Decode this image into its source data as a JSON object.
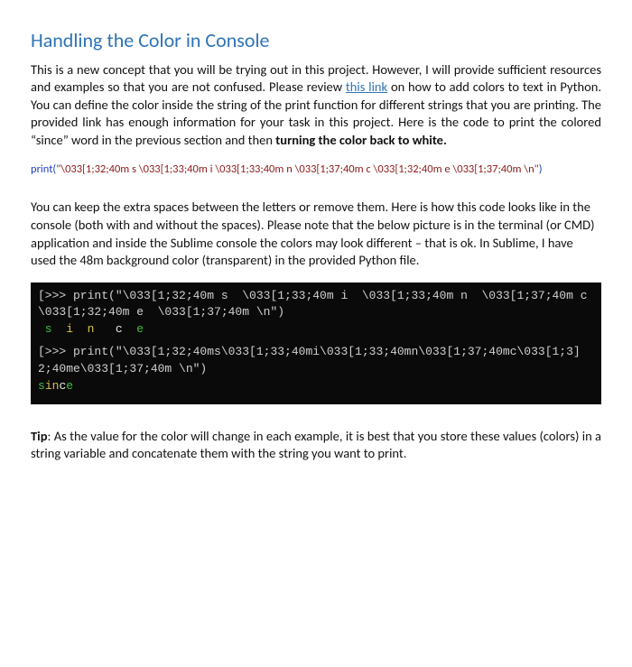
{
  "heading": "Handling the Color in Console",
  "intro": {
    "part1": "This is a new concept that you will be trying out in this project. However, I will provide sufficient resources and examples so that you are not confused. Please review ",
    "link_text": "this link",
    "part2": " on how to add colors to text in Python. You can define the color inside the string of the print function for different strings that you are printing. The provided link has enough information for your task in this project. Here is the code to print the colored “since” word in the previous section and then ",
    "bold_tail": "turning the color back to white."
  },
  "code_inline": {
    "lead": "print(",
    "string": "\"\\033[1;32;40m s \\033[1;33;40m i \\033[1;33;40m n \\033[1;37;40m c \\033[1;32;40m e \\033[1;37;40m \\n\"",
    "tail": ")"
  },
  "mid_para": "You can keep the extra spaces between the letters or remove them. Here is how this code looks like in the console (both with and without the spaces). Please note that the below picture is in the terminal (or CMD) application and inside the Sublime console the colors may look different – that is ok. In Sublime, I have used the 48m background color (transparent) in the provided Python file.",
  "terminal": {
    "line1": "[>>> print(\"\\033[1;32;40m s  \\033[1;33;40m i  \\033[1;33;40m n  \\033[1;37;40m c  ]",
    "line2": "\\033[1;32;40m e  \\033[1;37;40m \\n\")",
    "out1": {
      "s": " s",
      "i": "  i",
      "n": "  n",
      "c": "   c",
      "e": "  e"
    },
    "line3": "[>>> print(\"\\033[1;32;40ms\\033[1;33;40mi\\033[1;33;40mn\\033[1;37;40mc\\033[1;3]",
    "line4": "2;40me\\033[1;37;40m \\n\")",
    "out2": {
      "s": "s",
      "i": "i",
      "n": "n",
      "c": "c",
      "e": "e"
    }
  },
  "tip": {
    "label": "Tip",
    "body": ": As the value for the color will change in each example, it is best that you store these values (colors) in a string variable and concatenate them with the string you want to print."
  }
}
